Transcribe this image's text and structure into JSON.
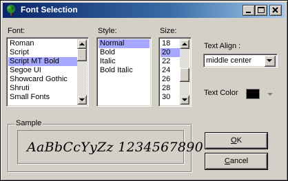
{
  "window": {
    "title": "Font Selection"
  },
  "icons": {
    "app_icon": "tree-icon",
    "minimize": "minimize-icon",
    "maximize": "maximize-icon",
    "close": "close-icon"
  },
  "font_section": {
    "label": "Font:",
    "items": [
      "Roman",
      "Script",
      "Script MT Bold",
      "Segoe UI",
      "Showcard Gothic",
      "Shruti",
      "Small Fonts"
    ],
    "selected": "Script MT Bold"
  },
  "style_section": {
    "label": "Style:",
    "items": [
      "Normal",
      "Bold",
      "Italic",
      "Bold Italic"
    ],
    "selected": "Normal"
  },
  "size_section": {
    "label": "Size:",
    "items": [
      "18",
      "20",
      "22",
      "24",
      "26",
      "28",
      "30"
    ],
    "selected": "20"
  },
  "text_align": {
    "label": "Text Align :",
    "value": "middle center"
  },
  "text_color": {
    "label": "Text Color",
    "value": "#000000"
  },
  "sample": {
    "caption": "Sample",
    "text": "AaBbCcYyZz 1234567890"
  },
  "buttons": {
    "ok_label": "OK",
    "ok_mnemonic": "O",
    "ok_rest": "K",
    "cancel_mnemonic": "C",
    "cancel_rest": "ancel"
  },
  "colors": {
    "selection": "#a6a8ff",
    "title_bar": "#0a246a",
    "face": "#d4d0c8"
  }
}
